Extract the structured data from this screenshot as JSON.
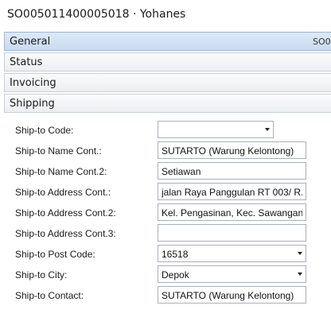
{
  "page": {
    "title": "SO005011400005018 · Yohanes"
  },
  "fasttabs": {
    "general": {
      "label": "General",
      "summary": "SO0"
    },
    "status": {
      "label": "Status"
    },
    "invoicing": {
      "label": "Invoicing"
    },
    "shipping": {
      "label": "Shipping"
    }
  },
  "shipping": {
    "fields": [
      {
        "label": "Ship-to Code:",
        "value": ""
      },
      {
        "label": "Ship-to Name Cont.:",
        "value": "SUTARTO (Warung Kelontong)"
      },
      {
        "label": "Ship-to Name Cont.2:",
        "value": "Setiawan"
      },
      {
        "label": "Ship-to Address Cont.:",
        "value": "jalan Raya Panggulan  RT 003/ R..."
      },
      {
        "label": "Ship-to Address Cont.2:",
        "value": "Kel. Pengasinan, Kec. Sawangan ..."
      },
      {
        "label": "Ship-to Address Cont.3:",
        "value": ""
      },
      {
        "label": "Ship-to Post Code:",
        "value": "16518"
      },
      {
        "label": "Ship-to City:",
        "value": "Depok"
      },
      {
        "label": "Ship-to Contact:",
        "value": "SUTARTO (Warung Kelontong)"
      }
    ]
  },
  "icons": {
    "dropdown": "chevron-down-icon"
  },
  "colors": {
    "selected_tab": "#c9dbf0",
    "tab_border": "#c9ced6",
    "field_border": "#a9b0bb"
  }
}
